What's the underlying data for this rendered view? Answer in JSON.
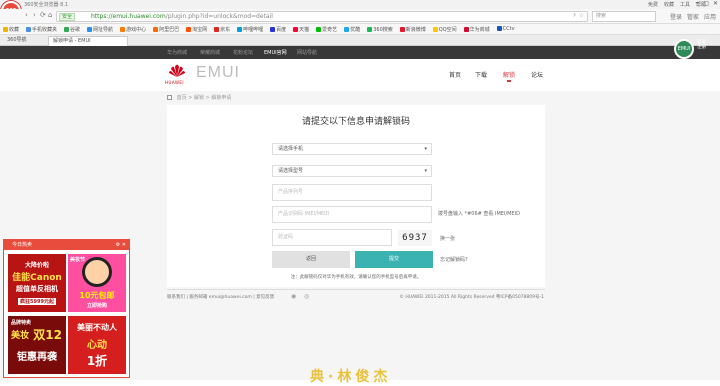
{
  "browser": {
    "logo_text": "360",
    "window_title": "360安全浏览器 8.1",
    "top_links": [
      "免费",
      "收藏",
      "工具",
      "帮助"
    ],
    "win_buttons": [
      "─",
      "□",
      "✕"
    ],
    "nav_buttons": [
      "‹",
      "›",
      "⟳",
      "⌂"
    ],
    "secure_label": "安全",
    "url_host": "https://emui.huawei.com",
    "url_path": "/plugin.php?id=unlock&mod=detail",
    "addr_icons": "⚡ ☆",
    "search_placeholder": "搜索",
    "nav_right": [
      "登录",
      "管家",
      "应用"
    ],
    "bookmarks": [
      "收藏",
      "手机收藏夹",
      "谷歌",
      "网址导航",
      "游戏中心",
      "阿里巴巴",
      "淘宝网",
      "京东",
      "哔哩哔哩",
      "百度",
      "天猫",
      "爱奇艺",
      "优酷",
      "360搜索",
      "新浪微博",
      "QQ空间",
      "华为商城",
      "CCtv"
    ],
    "tabs": [
      {
        "label": "360导航"
      },
      {
        "label": "解锁申请 - EMUI"
      }
    ]
  },
  "site": {
    "topnav": [
      "华为商城",
      "荣耀商城",
      "花粉论坛",
      "EMUI官网",
      "网站导航"
    ],
    "user_badge": "EMUI",
    "user_lines": [
      "登录",
      "注册"
    ],
    "brand": "HUAWEI",
    "product": "EMUI",
    "menu": [
      "首页",
      "下载",
      "解锁",
      "论坛"
    ],
    "breadcrumb": [
      "首页",
      "解锁",
      "解锁申请"
    ]
  },
  "form": {
    "title": "请提交以下信息申请解锁码",
    "device_select": "请选择手机",
    "model_select": "请选择型号",
    "serial_placeholder": "产品序列号",
    "imei_placeholder": "产品识别码 IMEI/MEID",
    "imei_hint": [
      "拨号盘输入 *#06# 查看",
      "IMEI/MEID"
    ],
    "captcha_placeholder": "验证码",
    "captcha_text": "6937",
    "captcha_refresh": "换一张",
    "back_label": "返回",
    "submit_label": "提交",
    "forgot_label": "忘记解锁码?",
    "footnote": "注：此解锁码仅对华为手机有效，请确认您的手机型号后再申请。"
  },
  "footer": {
    "left": "联系我们 | 服务邮箱 emui@huawei.com | 意见反馈",
    "right": "© HUAWEI 2011-2015 All Rights Reserved 粤ICP备05078809号-1"
  },
  "popup": {
    "title": "今日热卖",
    "controls": "⚙ ✕",
    "ads": [
      {
        "lines": [
          "大降价啦",
          "佳能Canon",
          "超值单反相机",
          "疯狂5999元起"
        ]
      },
      {
        "lines": [
          "美妆节",
          "10元包邮",
          "立即抢购"
        ]
      },
      {
        "lines": [
          "品牌特卖",
          "美妆",
          "双12",
          "钜惠再袭"
        ]
      },
      {
        "lines": [
          "美丽不动人",
          "心动",
          "1折"
        ]
      }
    ]
  },
  "bottom_text": "典·林俊杰"
}
